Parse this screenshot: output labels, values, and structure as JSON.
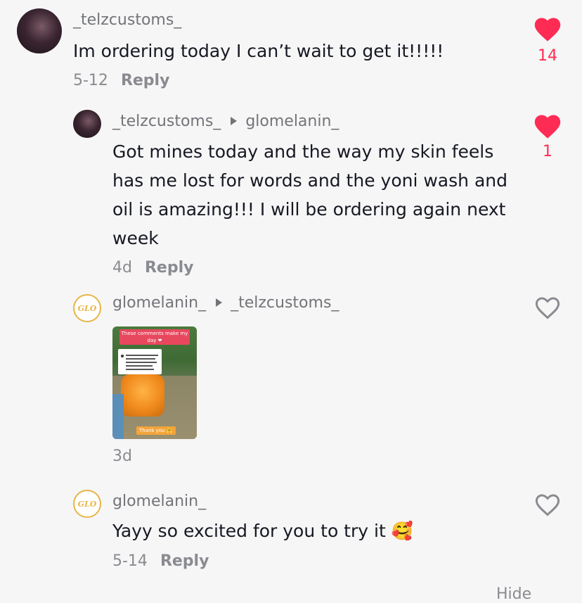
{
  "comments": [
    {
      "username": "_telzcustoms_",
      "text": "Im ordering today I can’t wait to get it!!!!!",
      "date": "5-12",
      "reply_label": "Reply",
      "likes": "14",
      "liked": true
    },
    {
      "username": "_telzcustoms_",
      "reply_to": "glomelanin_",
      "text": "Got mines today and the way my skin feels has me lost for words and the yoni wash and oil is amazing!!! I will be ordering again next week",
      "date": "4d",
      "reply_label": "Reply",
      "likes": "1",
      "liked": true
    },
    {
      "username": "glomelanin_",
      "reply_to": "_telzcustoms_",
      "avatar_text": "GLO",
      "video_caption": "These comments make my day ❤",
      "video_sticker": "Thank you 🤗",
      "date": "3d",
      "liked": false
    },
    {
      "username": "glomelanin_",
      "avatar_text": "GLO",
      "text": "Yayy so excited for you to try it 🥰",
      "date": "5-14",
      "reply_label": "Reply",
      "liked": false
    }
  ],
  "footer_partial": "Hide",
  "colors": {
    "like_active": "#fe2c55",
    "meta": "#8a8b91",
    "username": "#737479"
  }
}
